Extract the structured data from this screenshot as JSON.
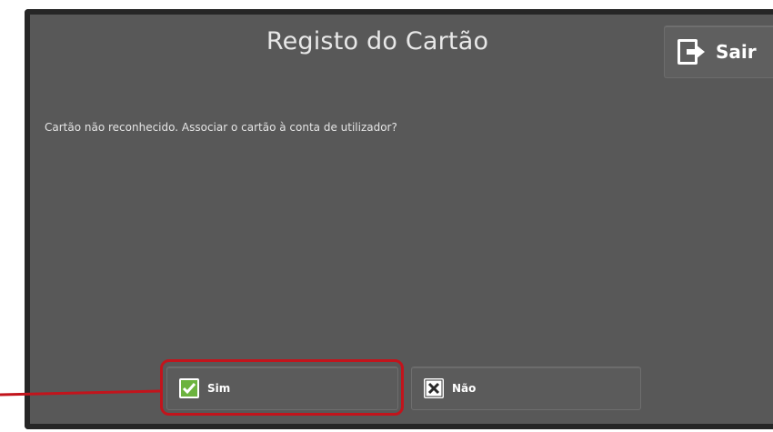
{
  "dialog": {
    "title": "Registo do Cartão",
    "message": "Cartão não reconhecido. Associar o cartão à conta de utilizador?"
  },
  "exit_button": {
    "label": "Sair",
    "icon": "exit-door-icon"
  },
  "buttons": {
    "yes": {
      "label": "Sim",
      "icon": "checkbox-check-icon",
      "icon_color": "#6cb33f"
    },
    "no": {
      "label": "Não",
      "icon": "checkbox-x-icon",
      "icon_color": "#ffffff"
    }
  },
  "annotation": {
    "highlight_color": "#c2141c"
  }
}
